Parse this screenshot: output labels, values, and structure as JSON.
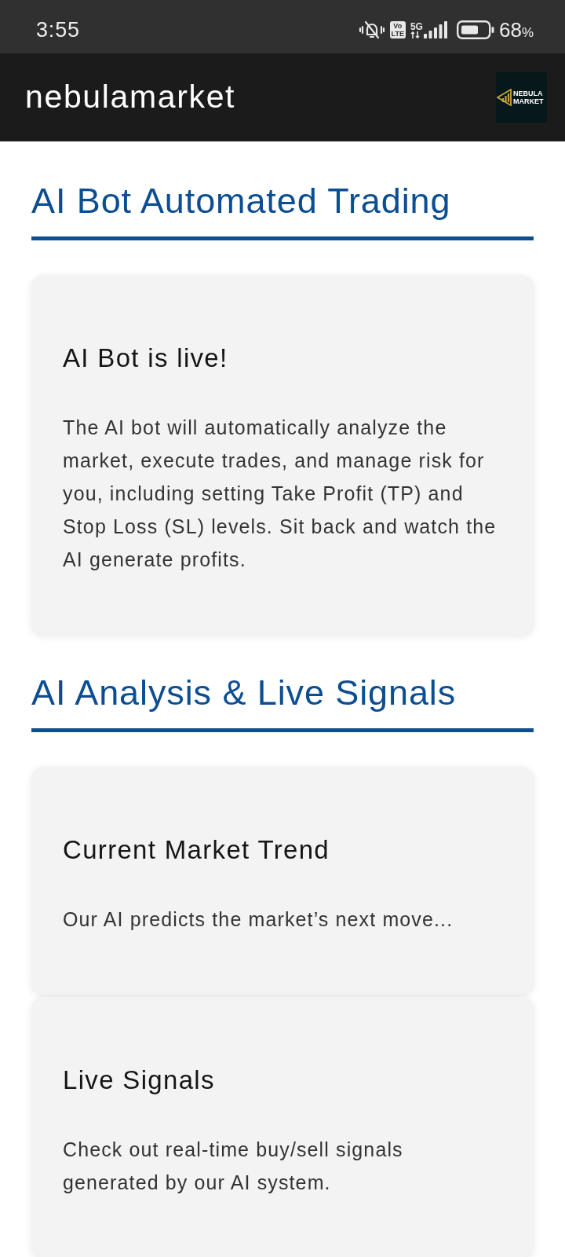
{
  "status_bar": {
    "time": "3:55",
    "volte_badge": [
      "Vo",
      "LTE"
    ],
    "network_type": "5G",
    "battery_percent": "68",
    "battery_unit": "%"
  },
  "app_bar": {
    "title": "nebulamarket",
    "logo": {
      "lines": [
        "NEBULA",
        "MARKET"
      ]
    }
  },
  "sections": [
    {
      "heading": "AI Bot Automated Trading",
      "cards": [
        {
          "title": "AI Bot is live!",
          "body": "The AI bot will automatically analyze the market, execute trades, and manage risk for you, including setting Take Profit (TP) and Stop Loss (SL) levels. Sit back and watch the AI generate profits."
        }
      ]
    },
    {
      "heading": "AI Analysis & Live Signals",
      "cards": [
        {
          "title": "Current Market Trend",
          "body": "Our AI predicts the market’s next move..."
        },
        {
          "title": "Live Signals",
          "body": "Check out real-time buy/sell signals generated by our AI system."
        }
      ]
    }
  ]
}
